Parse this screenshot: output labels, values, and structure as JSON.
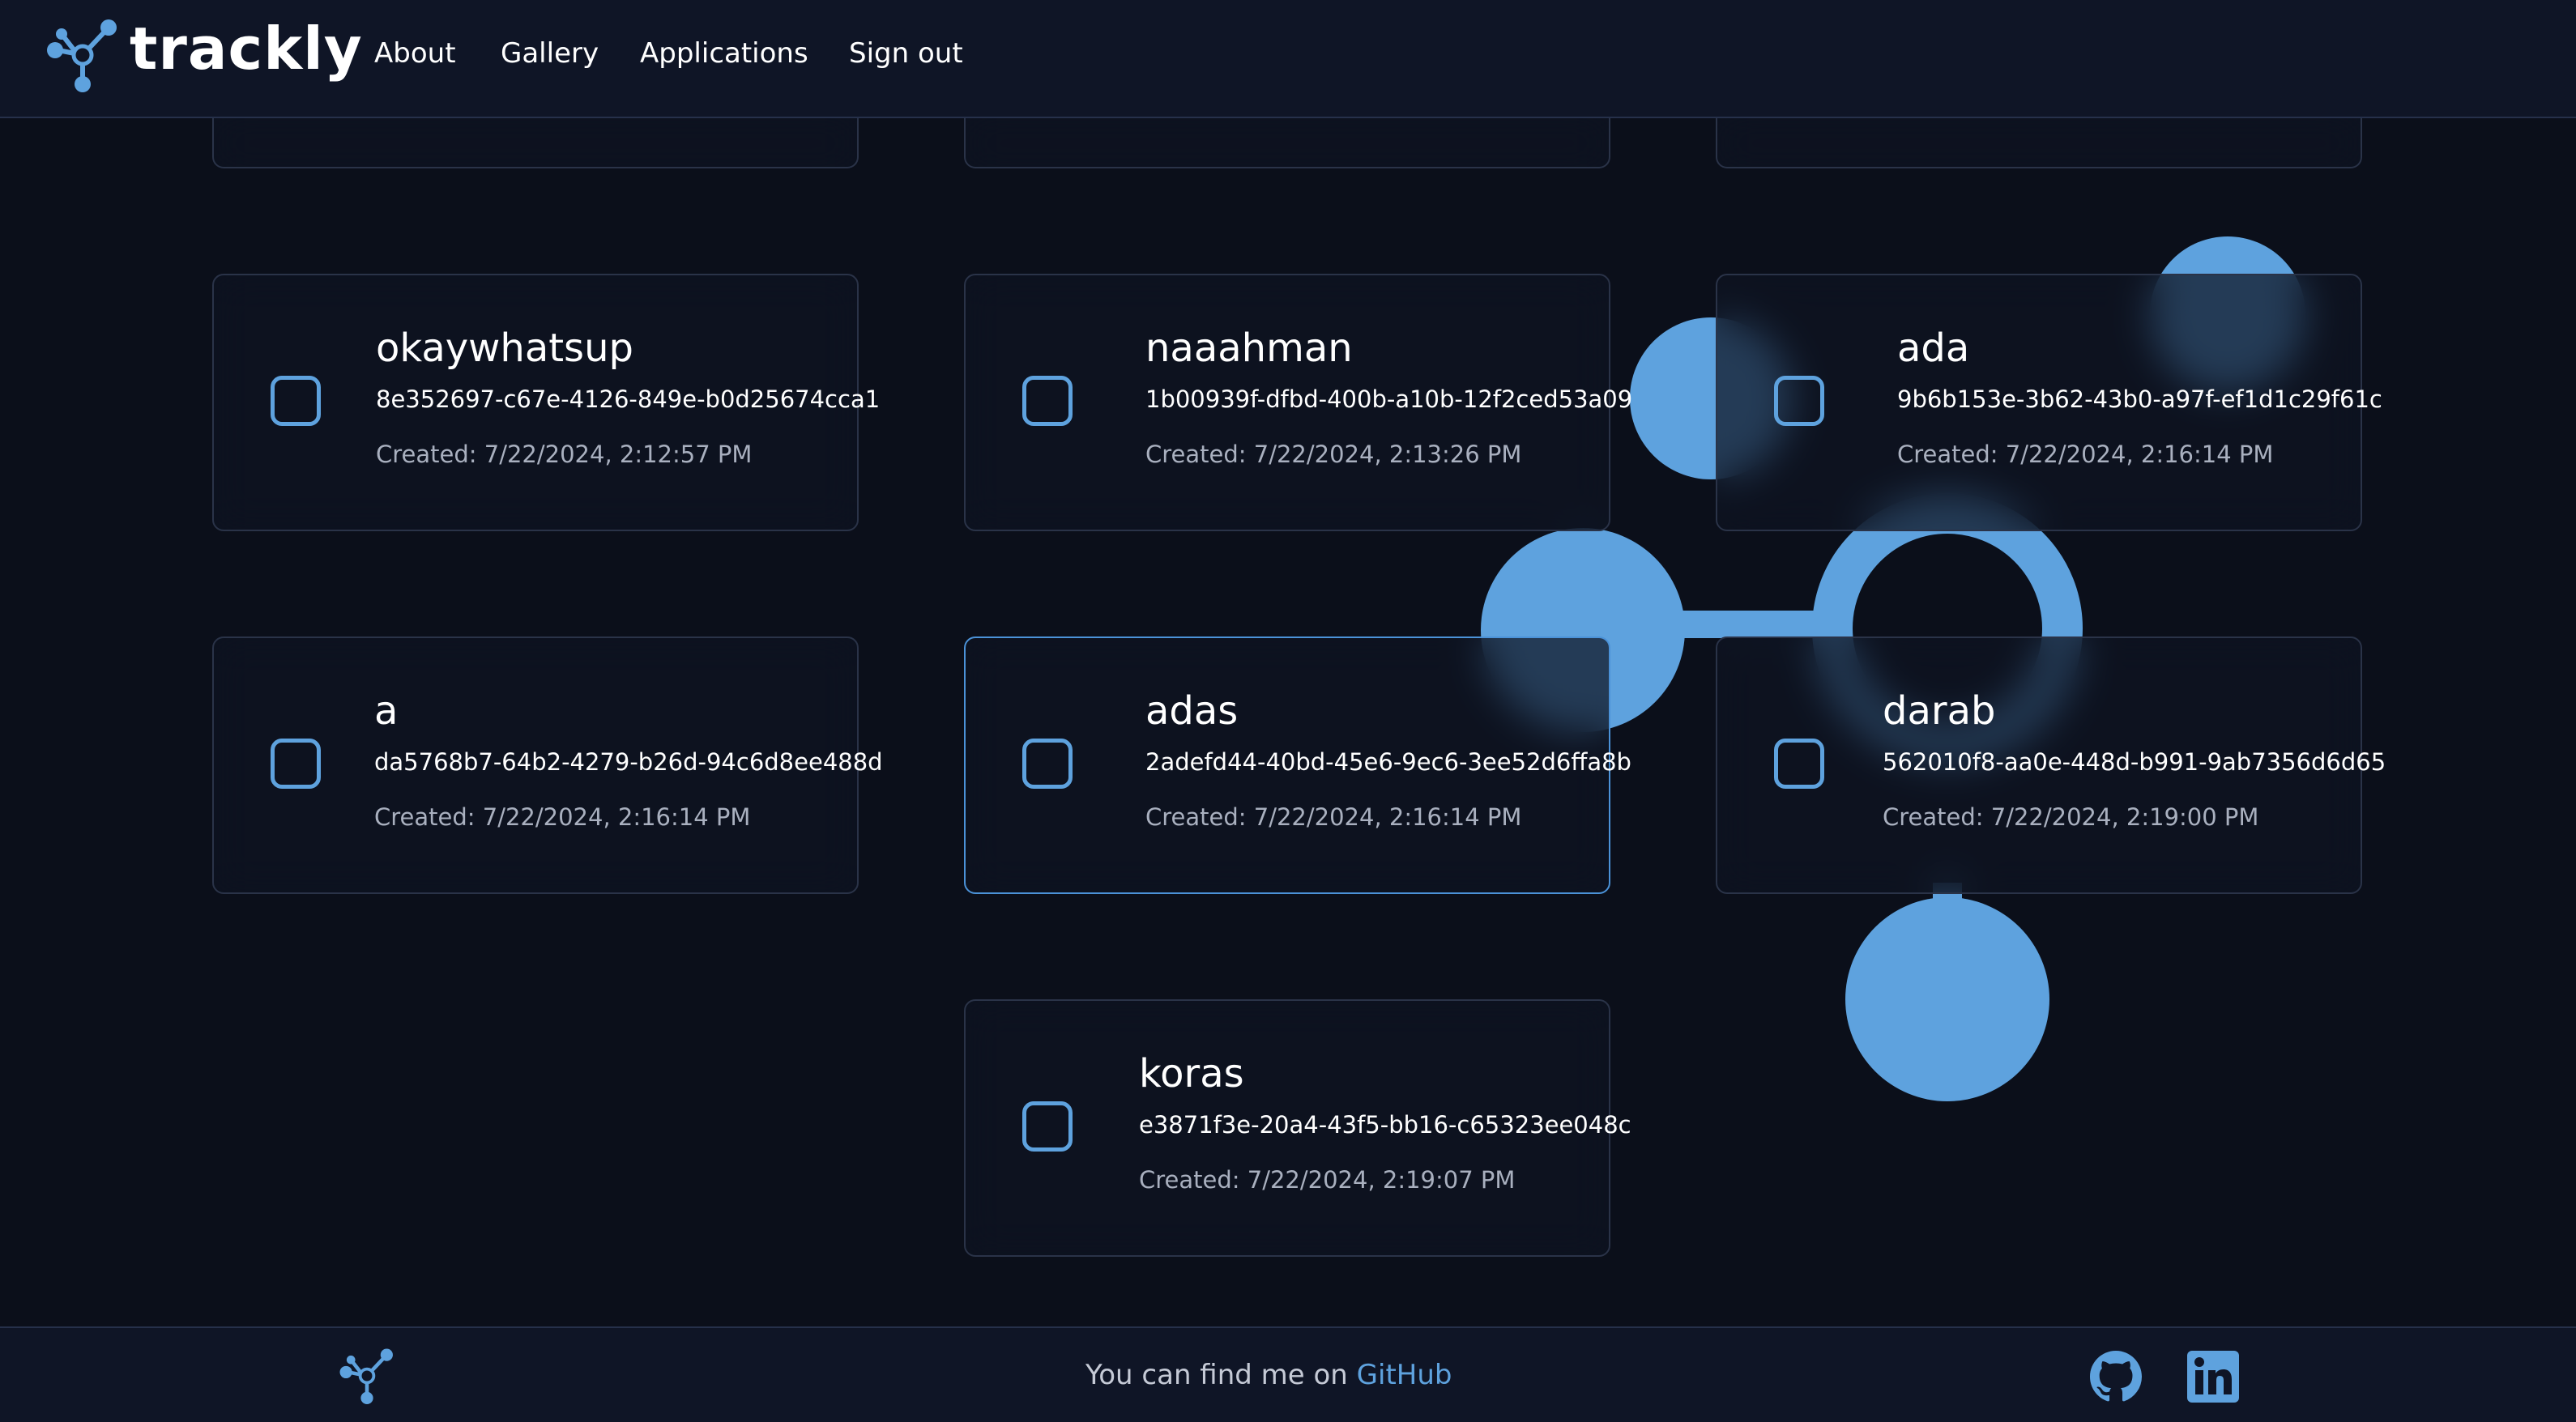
{
  "header": {
    "brand": "trackly",
    "nav": [
      {
        "label": "About"
      },
      {
        "label": "Gallery"
      },
      {
        "label": "Applications"
      },
      {
        "label": "Sign out"
      }
    ]
  },
  "applications": [
    {
      "name": "okaywhatsup",
      "id": "8e352697-c67e-4126-849e-b0d25674cca1",
      "created": "Created: 7/22/2024, 2:12:57 PM",
      "checked": false
    },
    {
      "name": "naaahman",
      "id": "1b00939f-dfbd-400b-a10b-12f2ced53a09",
      "created": "Created: 7/22/2024, 2:13:26 PM",
      "checked": false
    },
    {
      "name": "ada",
      "id": "9b6b153e-3b62-43b0-a97f-ef1d1c29f61c",
      "created": "Created: 7/22/2024, 2:16:14 PM",
      "checked": false
    },
    {
      "name": "a",
      "id": "da5768b7-64b2-4279-b26d-94c6d8ee488d",
      "created": "Created: 7/22/2024, 2:16:14 PM",
      "checked": false
    },
    {
      "name": "adas",
      "id": "2adefd44-40bd-45e6-9ec6-3ee52d6ffa8b",
      "created": "Created: 7/22/2024, 2:16:14 PM",
      "checked": false
    },
    {
      "name": "darab",
      "id": "562010f8-aa0e-448d-b991-9ab7356d6d65",
      "created": "Created: 7/22/2024, 2:19:00 PM",
      "checked": false
    },
    {
      "name": "koras",
      "id": "e3871f3e-20a4-43f5-bb16-c65323ee048c",
      "created": "Created: 7/22/2024, 2:19:07 PM",
      "checked": false
    }
  ],
  "footer": {
    "text": "You can find me on",
    "link": "GitHub",
    "icons": [
      "github-icon",
      "linkedin-icon"
    ]
  },
  "colors": {
    "background": "#0b0f1a",
    "header_bg": "#0f1526",
    "accent": "#5ea2de",
    "card_border": "#2a3348",
    "selected_border": "#4b92d8"
  }
}
